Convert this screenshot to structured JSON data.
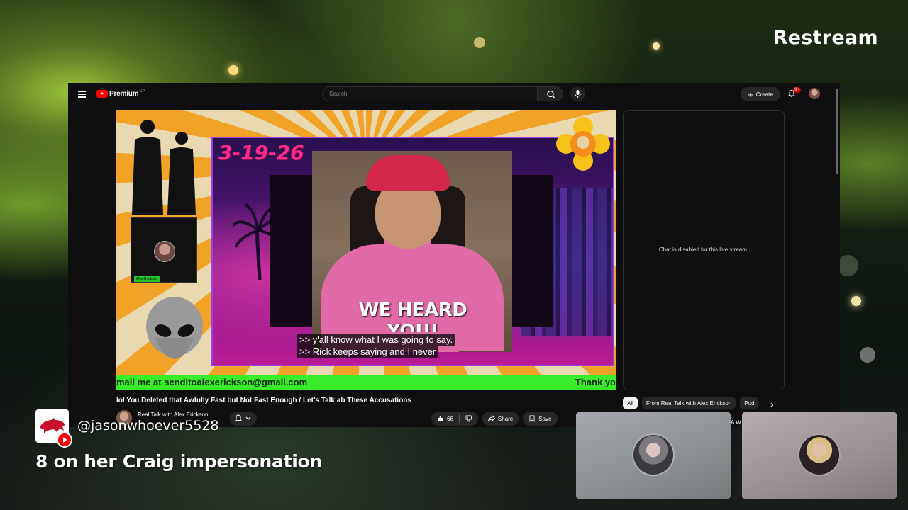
{
  "brand": "Restream",
  "youtube": {
    "logo_text": "Premium",
    "logo_region": "CA",
    "search_placeholder": "Search",
    "create_label": "Create",
    "notifications_badge": "9+",
    "video": {
      "date_text": "3-19-26",
      "overlay_line1": "WE HEARD",
      "overlay_line2": "YOU!",
      "captions": [
        ">> y'all know what I was going to say.",
        ">> Rick keeps saying and I never"
      ],
      "camera_name": "Alex Erickson",
      "ticker_left": "mail me at senditoalexerickson@gmail.com",
      "ticker_right": "Thank yo"
    },
    "chat_disabled_text": "Chat is disabled for this live stream.",
    "title": "lol You Deleted that Awfully Fast but Not Fast Enough / Let’s Talk ab These Accusations",
    "channel_name": "Real Talk with Alex Erickson",
    "likes": "66",
    "share_label": "Share",
    "save_label": "Save",
    "chips": [
      "All",
      "From Real Talk with Alex Erickson",
      "Pod"
    ]
  },
  "comment": {
    "username": "@jasonwhoever5528",
    "message": "8 on her Craig impersonation"
  },
  "tile_overflow_text": "A W",
  "colors": {
    "yt_bg": "#0f0f0f",
    "yt_red": "#ff0000",
    "ticker_green": "#3aed2a",
    "neon_pink": "#ff2a8a"
  }
}
